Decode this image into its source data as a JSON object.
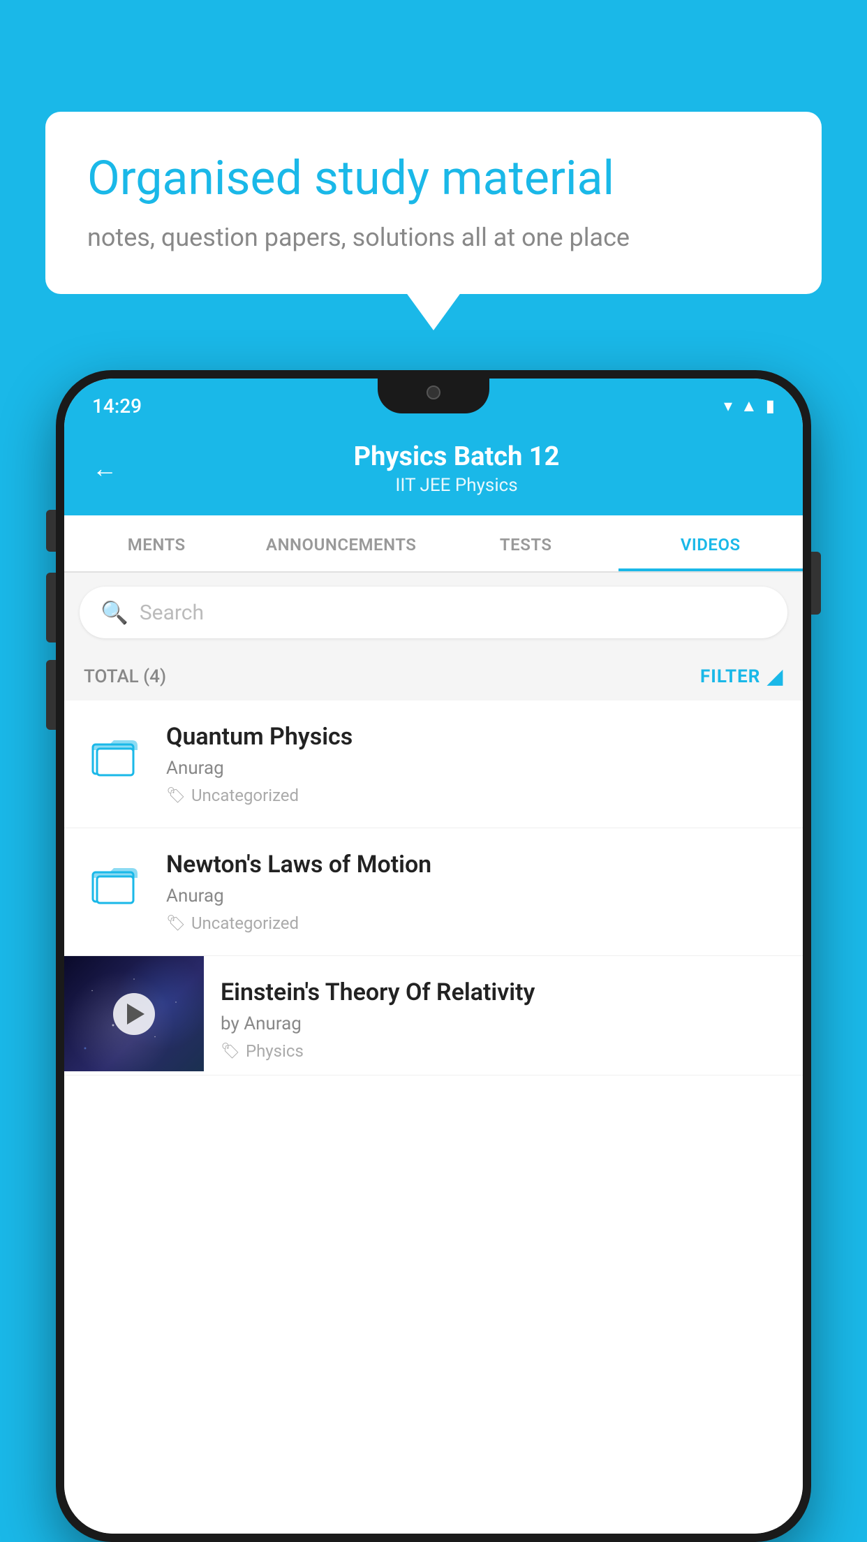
{
  "background_color": "#1ab8e8",
  "speech_bubble": {
    "title": "Organised study material",
    "subtitle": "notes, question papers, solutions all at one place"
  },
  "phone": {
    "status_bar": {
      "time": "14:29"
    },
    "header": {
      "back_label": "←",
      "title": "Physics Batch 12",
      "subtitle": "IIT JEE   Physics"
    },
    "tabs": [
      {
        "label": "MENTS",
        "active": false
      },
      {
        "label": "ANNOUNCEMENTS",
        "active": false
      },
      {
        "label": "TESTS",
        "active": false
      },
      {
        "label": "VIDEOS",
        "active": true
      }
    ],
    "search": {
      "placeholder": "Search"
    },
    "filter_row": {
      "total_label": "TOTAL (4)",
      "filter_label": "FILTER"
    },
    "videos": [
      {
        "title": "Quantum Physics",
        "author": "Anurag",
        "tag": "Uncategorized",
        "type": "folder"
      },
      {
        "title": "Newton's Laws of Motion",
        "author": "Anurag",
        "tag": "Uncategorized",
        "type": "folder"
      },
      {
        "title": "Einstein's Theory Of Relativity",
        "author": "by Anurag",
        "tag": "Physics",
        "type": "video"
      }
    ]
  }
}
